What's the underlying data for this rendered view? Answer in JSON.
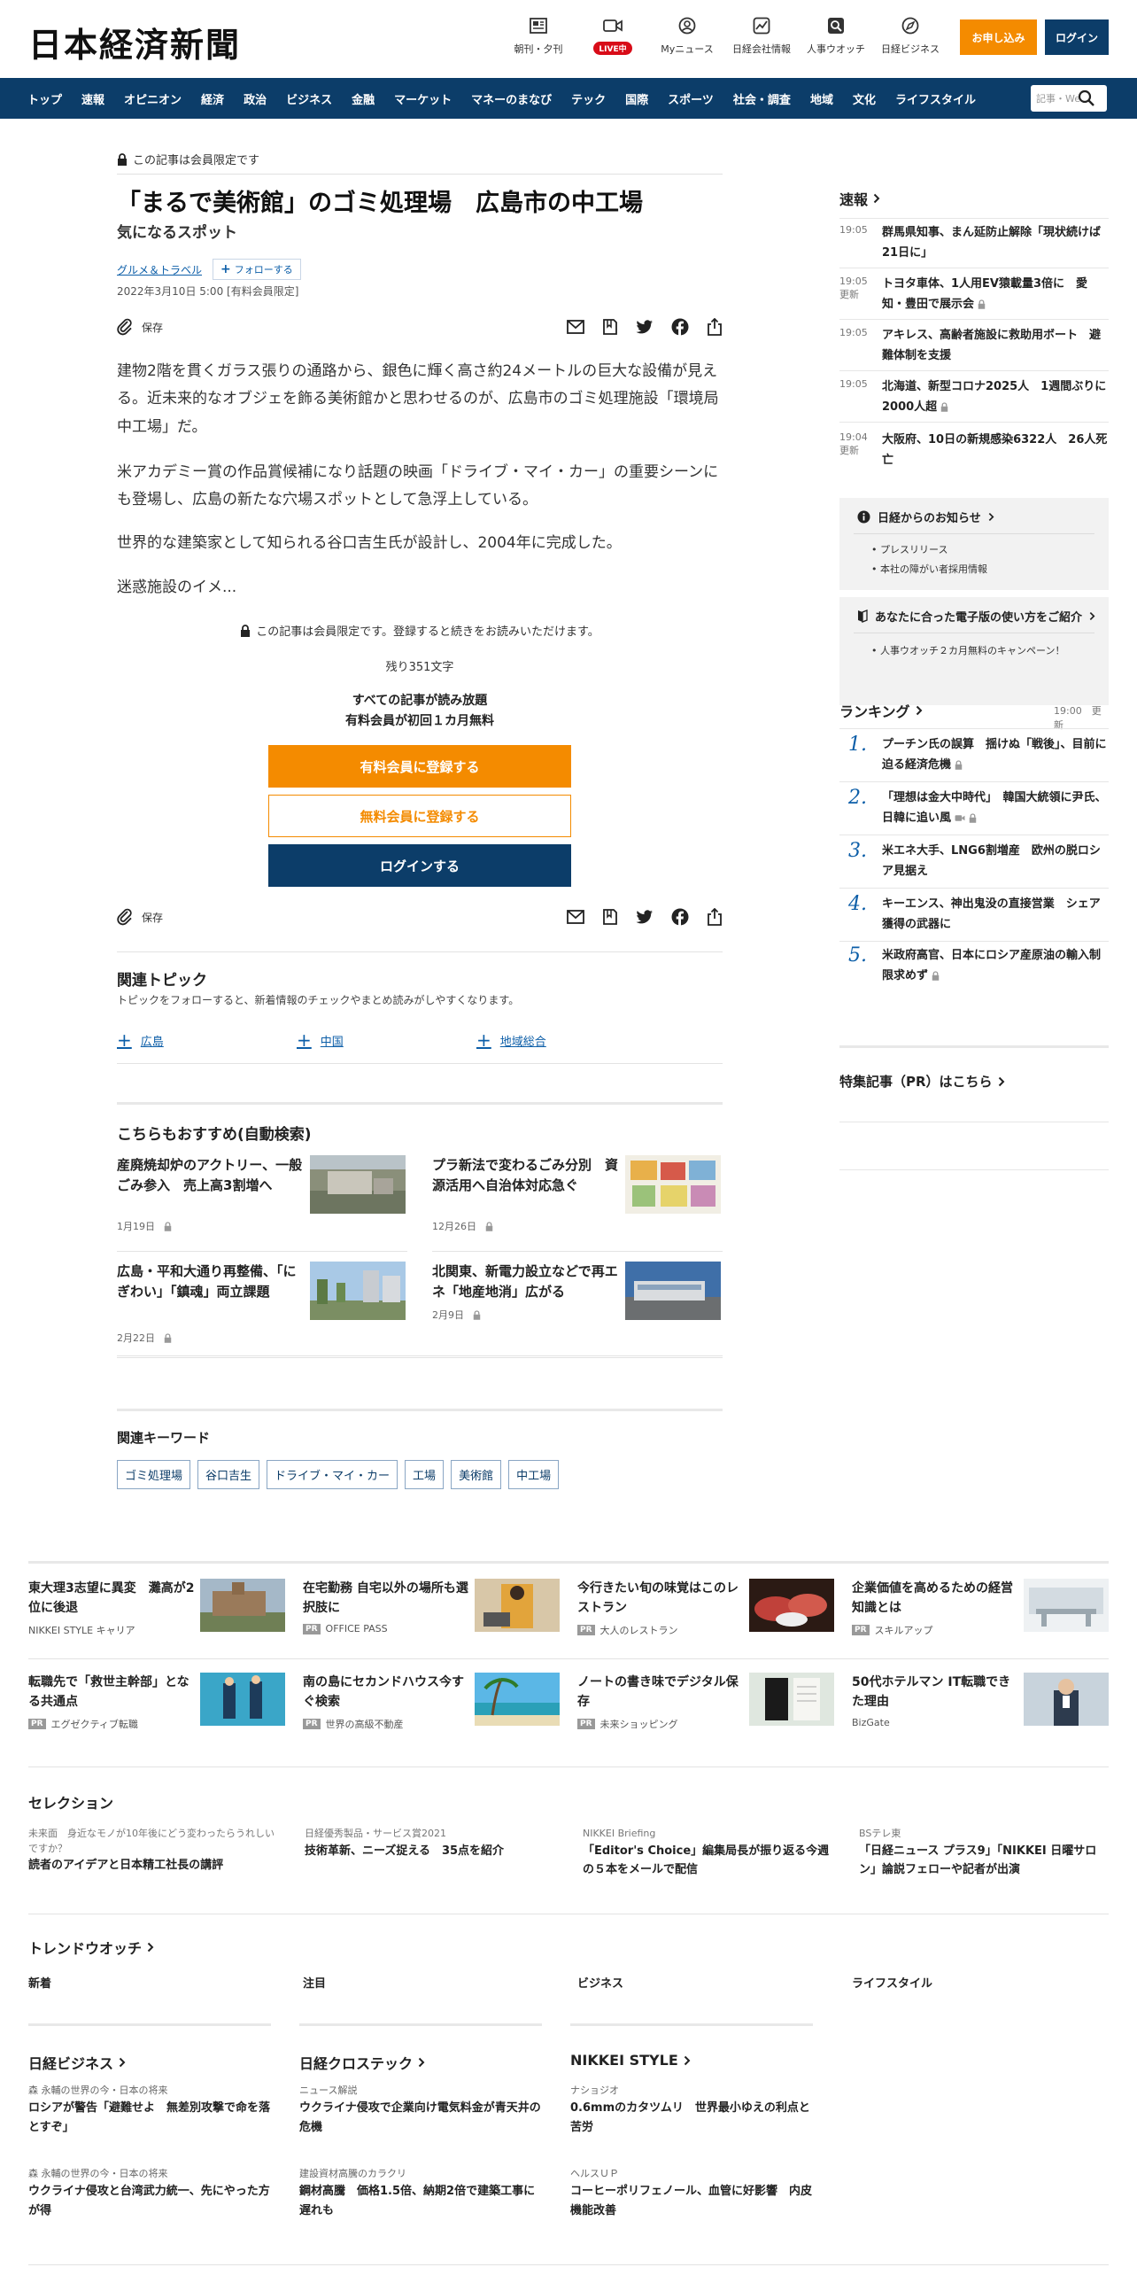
{
  "header": {
    "logo": "日本経済新聞",
    "utilities": [
      {
        "label": "朝刊・夕刊",
        "icon": "newspaper-icon"
      },
      {
        "label": "LIVE中",
        "icon": "video-icon"
      },
      {
        "label": "Myニュース",
        "icon": "user-icon"
      },
      {
        "label": "日経会社情報",
        "icon": "chart-icon"
      },
      {
        "label": "人事ウオッチ",
        "icon": "search-person-icon"
      },
      {
        "label": "日経ビジネス",
        "icon": "compass-icon"
      }
    ],
    "apply_label": "お申し込み",
    "login_label": "ログイン"
  },
  "nav": {
    "items": [
      "トップ",
      "速報",
      "オピニオン",
      "経済",
      "政治",
      "ビジネス",
      "金融",
      "マーケット",
      "マネーのまなび",
      "テック",
      "国際",
      "スポーツ",
      "社会・調査",
      "地域",
      "文化",
      "ライフスタイル"
    ],
    "search_placeholder": "記事・We"
  },
  "article": {
    "members_only": "この記事は会員限定です",
    "title": "「まるで美術館」のゴミ処理場　広島市の中工場",
    "subtitle": "気になるスポット",
    "category": "グルメ＆トラベル",
    "follow_label": "フォローする",
    "date": "2022年3月10日 5:00 [有料会員限定]",
    "save_label": "保存",
    "paragraphs": [
      "建物2階を貫くガラス張りの通路から、銀色に輝く高さ約24メートルの巨大な設備が見える。近未来的なオブジェを飾る美術館かと思わせるのが、広島市のゴミ処理施設「環境局中工場」だ。",
      "米アカデミー賞の作品賞候補になり話題の映画「ドライブ・マイ・カー」の重要シーンにも登場し、広島の新たな穴場スポットとして急浮上している。",
      "世界的な建築家として知られる谷口吉生氏が設計し、2004年に完成した。",
      "迷惑施設のイメ..."
    ],
    "paywall_note": "この記事は会員限定です。登録すると続きをお読みいただけます。",
    "remaining": "残り351文字",
    "all_read_1": "すべての記事が読み放題",
    "all_read_2": "有料会員が初回１カ月無料",
    "cta_paid": "有料会員に登録する",
    "cta_free": "無料会員に登録する",
    "cta_login": "ログインする"
  },
  "related_topics": {
    "heading": "関連トピック",
    "description": "トピックをフォローすると、新着情報のチェックやまとめ読みがしやすくなります。",
    "items": [
      "広島",
      "中国",
      "地域総合"
    ]
  },
  "recommend": {
    "heading": "こちらもおすすめ(自動検索)",
    "items": [
      {
        "title": "産廃焼却炉のアクトリー、一般ごみ参入　売上高3割増へ",
        "date": "1月19日"
      },
      {
        "title": "プラ新法で変わるごみ分別　資源活用へ自治体対応急ぐ",
        "date": "12月26日"
      },
      {
        "title": "広島・平和大通り再整備、「にぎわい」「鎮魂」両立課題",
        "date": "2月22日"
      },
      {
        "title": "北関東、新電力設立などで再エネ「地産地消」広がる",
        "date": "2月9日"
      }
    ]
  },
  "keywords": {
    "heading": "関連キーワード",
    "items": [
      "ゴミ処理場",
      "谷口吉生",
      "ドライブ・マイ・カー",
      "工場",
      "美術館",
      "中工場"
    ]
  },
  "sidebar": {
    "breaking_heading": "速報",
    "breaking": [
      {
        "time": "19:05",
        "title": "群馬県知事、まん延防止解除「現状続けば21日に」",
        "updated": ""
      },
      {
        "time": "19:05",
        "title": "トヨタ車体、1人用EV猿載量3倍に　愛知・豊田で展示会",
        "updated": "更新"
      },
      {
        "time": "19:05",
        "title": "アキレス、高齢者施設に救助用ボート　避難体制を支援",
        "updated": ""
      },
      {
        "time": "19:05",
        "title": "北海道、新型コロナ2025人　1週間ぶりに2000人超",
        "updated": ""
      },
      {
        "time": "19:04",
        "title": "大阪府、10日の新規感染6322人　26人死亡",
        "updated": "更新"
      }
    ],
    "notice_heading": "日経からのお知らせ",
    "notice_items": [
      "プレスリリース",
      "本社の障がい者採用情報"
    ],
    "guide_heading": "あなたに合った電子版の使い方をご紹介",
    "guide_items": [
      "人事ウオッチ２カ月無料のキャンペーン！"
    ],
    "ranking_heading": "ランキング",
    "ranking_time": "19:00",
    "ranking_updated": "更新",
    "ranking": [
      {
        "no": "1.",
        "title": "プーチン氏の誤算　揺けぬ「戦後」、目前に迫る経済危機"
      },
      {
        "no": "2.",
        "title": "「理想は金大中時代」　韓国大統領に尹氏、日韓に追い風"
      },
      {
        "no": "3.",
        "title": "米エネ大手、LNG6割増産　欧州の脱ロシア見据え"
      },
      {
        "no": "4.",
        "title": "キーエンス、神出鬼没の直接営業　シェア獲得の武器に"
      },
      {
        "no": "5.",
        "title": "米政府高官、日本にロシア産原油の輸入制限求めず"
      }
    ],
    "pr_heading": "特集記事（PR）はこちら"
  },
  "promos": [
    {
      "title": "東大理3志望に異変　灘高が2位に後退",
      "source": "NIKKEI STYLE キャリア",
      "pr": false
    },
    {
      "title": "在宅勤務 自宅以外の場所も選択肢に",
      "source": "OFFICE PASS",
      "pr": true
    },
    {
      "title": "今行きたい旬の味覚はこのレストラン",
      "source": "大人のレストラン",
      "pr": true
    },
    {
      "title": "企業価値を高めるための経営知識とは",
      "source": "スキルアップ",
      "pr": true
    },
    {
      "title": "転職先で「救世主幹部」となる共通点",
      "source": "エグゼクティブ転職",
      "pr": true
    },
    {
      "title": "南の島にセカンドハウス今すぐ検索",
      "source": "世界の高級不動産",
      "pr": true
    },
    {
      "title": "ノートの書き味でデジタル保存",
      "source": "未来ショッピング",
      "pr": true
    },
    {
      "title": "50代ホテルマン IT転職できた理由",
      "source": "BizGate",
      "pr": false
    }
  ],
  "pr_label": "PR",
  "selection": {
    "heading": "セレクション",
    "items": [
      {
        "sub": "未来面　身近なモノが10年後にどう変わったらうれしいですか？",
        "title": "読者のアイデアと日本精工社長の講評"
      },
      {
        "sub": "日経優秀製品・サービス賞2021",
        "title": "技術革新、ニーズ捉える　35点を紹介"
      },
      {
        "sub": "NIKKEI Briefing",
        "title": "「Editor's Choice」編集局長が振り返る今週の５本をメールで配信"
      },
      {
        "sub": "BSテレ東",
        "title": "「日経ニュース プラス9」「NIKKEI 日曜サロン」論説フェローや記者が出演"
      }
    ]
  },
  "trend": {
    "heading": "トレンドウオッチ",
    "tabs": [
      "新着",
      "注目",
      "ビジネス",
      "ライフスタイル"
    ]
  },
  "brands": [
    {
      "heading": "日経ビジネス",
      "items": [
        {
          "sub": "森 永輔の世界の今・日本の将来",
          "title": "ロシアが警告「避難せよ　無差別攻撃で命を落とすぞ」"
        },
        {
          "sub": "森 永輔の世界の今・日本の将来",
          "title": "ウクライナ侵攻と台湾武力統一、先にやった方が得"
        }
      ]
    },
    {
      "heading": "日経クロステック",
      "items": [
        {
          "sub": "ニュース解説",
          "title": "ウクライナ侵攻で企業向け電気料金が青天井の危機"
        },
        {
          "sub": "建設資材高騰のカラクリ",
          "title": "鋼材高騰　価格1.5倍、納期2倍で建築工事に遅れも"
        }
      ]
    },
    {
      "heading": "NIKKEI STYLE",
      "items": [
        {
          "sub": "ナショジオ",
          "title": "0.6mmのカタツムリ　世界最小ゆえの利点と苦労"
        },
        {
          "sub": "ヘルスＵＰ",
          "title": "コーヒーポリフェノール、血管に好影響　内皮機能改善"
        }
      ]
    }
  ],
  "colors": {
    "navy": "#0c3d69",
    "orange": "#f48b00",
    "live_red": "#d80c18",
    "link_blue": "#0c5ea8"
  }
}
